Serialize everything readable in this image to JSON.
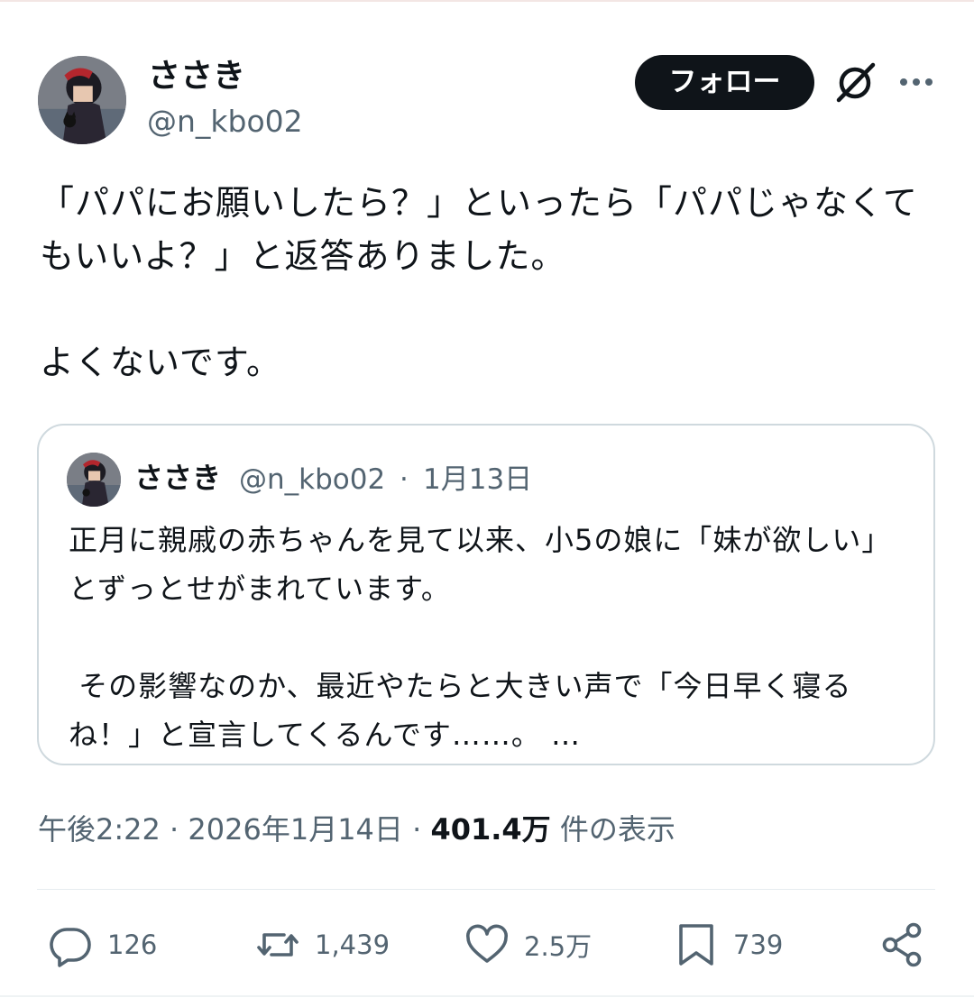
{
  "author": {
    "name": "ささき",
    "handle": "@n_kbo02",
    "follow_label": "フォロー"
  },
  "tweet": {
    "text": "「パパにお願いしたら？」といったら「パパじゃなくてもいいよ？」と返答ありました。\n\nよくないです。"
  },
  "quote": {
    "name": "ささき",
    "handle": "@n_kbo02",
    "separator": "·",
    "date": "1月13日",
    "text": "正月に親戚の赤ちゃんを見て以来、小5の娘に「妹が欲しい」とずっとせがまれています。\n\n その影響なのか、最近やたらと大きい声で「今日早く寝るね！」と宣言してくるんです……。 …"
  },
  "meta": {
    "time": "午後2:22",
    "sep1": " · ",
    "date": "2026年1月14日",
    "sep2": " · ",
    "views_count": "401.4万",
    "views_label": " 件の表示"
  },
  "actions": {
    "replies": "126",
    "retweets": "1,439",
    "likes": "2.5万",
    "bookmarks": "739"
  },
  "icons": {
    "reply": "reply-icon",
    "retweet": "retweet-icon",
    "like": "heart-icon",
    "bookmark": "bookmark-icon",
    "share": "share-icon",
    "grok": "grok-icon",
    "more": "more-icon"
  }
}
